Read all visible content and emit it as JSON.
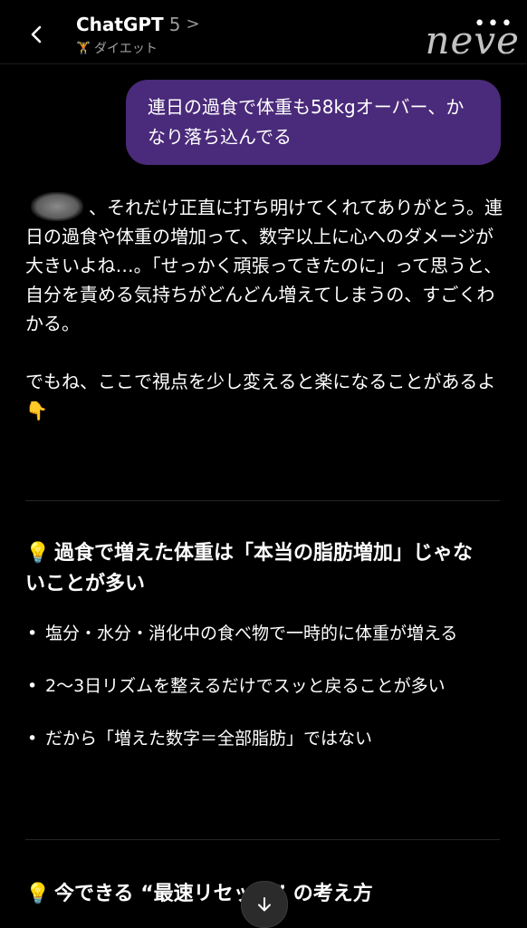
{
  "header": {
    "title": "ChatGPT",
    "version": "5",
    "chevron": ">",
    "project_icon": "🏋",
    "project": "ダイエット",
    "watermark": "neve",
    "more": "•••"
  },
  "user_message": "連日の過食で体重も58kgオーバー、かなり落ち込んでる",
  "assistant": {
    "para1": "、それだけ正直に打ち明けてくれてありがとう。連日の過食や体重の増加って、数字以上に心へのダメージが大きいよね…。「せっかく頑張ってきたのに」って思うと、自分を責める気持ちがどんどん増えてしまうの、すごくわかる。",
    "para2": "でもね、ここで視点を少し変えると楽になることがあるよ 👇",
    "section1_icon": "💡",
    "section1_title": "過食で増えた体重は「本当の脂肪増加」じゃないことが多い",
    "bullets": [
      "塩分・水分・消化中の食べ物で一時的に体重が増える",
      "2〜3日リズムを整えるだけでスッと戻ることが多い",
      "だから「増えた数字＝全部脂肪」ではない"
    ],
    "section2_icon": "💡",
    "section2_title": "今できる “最速リセット” の考え方"
  }
}
